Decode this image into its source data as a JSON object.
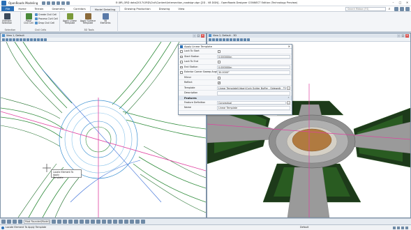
{
  "titlebar": {
    "workflow": "OpenRoads Modeling",
    "window_title": "E:\\RR_ORD data\\2017\\ORD\\Civil\\Content\\intersection_roadsign.dgn [2D - V8 DGN] - OpenRoads Designer CONNECT Edition (Technology Preview)"
  },
  "ribbon": {
    "tabs": [
      {
        "label": "File"
      },
      {
        "label": "Home"
      },
      {
        "label": "Terrain"
      },
      {
        "label": "Geometry"
      },
      {
        "label": "Corridors"
      },
      {
        "label": "Model Detailing"
      },
      {
        "label": "Drawing Production"
      },
      {
        "label": "Drawing"
      },
      {
        "label": "View"
      }
    ],
    "search_placeholder": "Search Ribbon (F4)",
    "groups": {
      "selection": {
        "label": "Selection",
        "element_selection": "Element Selection"
      },
      "civil_cells": {
        "label": "Civil Cells",
        "place_civil_cell": "Place Civil Cell",
        "create_civil_cell": "Create Civil Cell",
        "process_civil_cell": "Process Civil Cell",
        "drop_civil_cell": "Drop Civil Cell"
      },
      "3d_tools": {
        "label": "3D Tools",
        "apply_linear_template": "Apply Linear Template",
        "apply_surface_template": "Apply Surface Template",
        "3d_elements": "3D Elements"
      }
    }
  },
  "view1": {
    "title": "View 1, Default"
  },
  "view2": {
    "title": "View 2, Default - 3D"
  },
  "dialog": {
    "title": "Apply Linear Template",
    "rows": [
      {
        "name": "Lock To Start",
        "type": "check",
        "checked": false
      },
      {
        "name": "Start Station",
        "value": "0.000000m"
      },
      {
        "name": "Lock To End",
        "type": "check",
        "checked": false
      },
      {
        "name": "End Station",
        "value": "0.000000m"
      },
      {
        "name": "Exterior Corner Sweep Angle",
        "value": "30.0000°"
      },
      {
        "name": "Mirror",
        "type": "vcheck",
        "checked": false
      },
      {
        "name": "Reflect",
        "type": "vcheck",
        "checked": true
      },
      {
        "name": "Template",
        "value": "Linear Template\\Urban\\Curb Gutter Buffer - Sidewalk - Tie Slope"
      },
      {
        "name": "Description",
        "value": ""
      }
    ],
    "section_features": "Features",
    "feature_rows": [
      {
        "name": "Feature Definition",
        "value": "Conceptual"
      },
      {
        "name": "Name",
        "value": "Linear Template"
      }
    ]
  },
  "tooltip": {
    "line1": "Locate Element To Apply",
    "line2": "Template"
  },
  "bottom_toolbar": {
    "view_mode": "Most Rounded(Model)"
  },
  "statusbar": {
    "message": "Locate Element To Apply Template",
    "level": "Default"
  },
  "colors": {
    "brand": "#2a6fb6",
    "accent_magenta": "#e040a0",
    "road_green": "#2e8b3a",
    "terrain_dark": "#1d3a1a"
  }
}
